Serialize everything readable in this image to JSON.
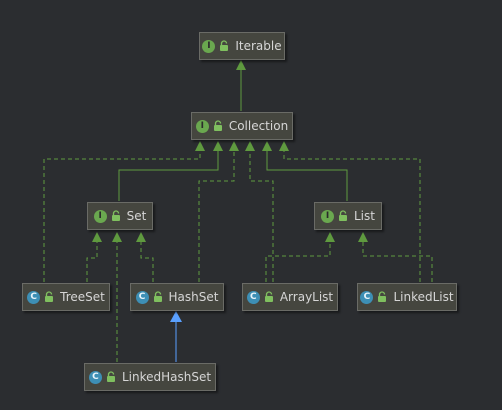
{
  "colors": {
    "background": "#2b2d30",
    "node_fill": "#45463f",
    "interface_badge": "#6aa84f",
    "class_badge": "#3d8fb5",
    "implements_edge": "#5f9a3f",
    "extends_edge": "#5aa0ff"
  },
  "nodes": {
    "iterable": {
      "label": "Iterable",
      "kind": "I"
    },
    "collection": {
      "label": "Collection",
      "kind": "I"
    },
    "set": {
      "label": "Set",
      "kind": "I"
    },
    "list": {
      "label": "List",
      "kind": "I"
    },
    "treeset": {
      "label": "TreeSet",
      "kind": "C"
    },
    "hashset": {
      "label": "HashSet",
      "kind": "C"
    },
    "arraylist": {
      "label": "ArrayList",
      "kind": "C"
    },
    "linkedlist": {
      "label": "LinkedList",
      "kind": "C"
    },
    "linkedhashset": {
      "label": "LinkedHashSet",
      "kind": "C"
    }
  }
}
